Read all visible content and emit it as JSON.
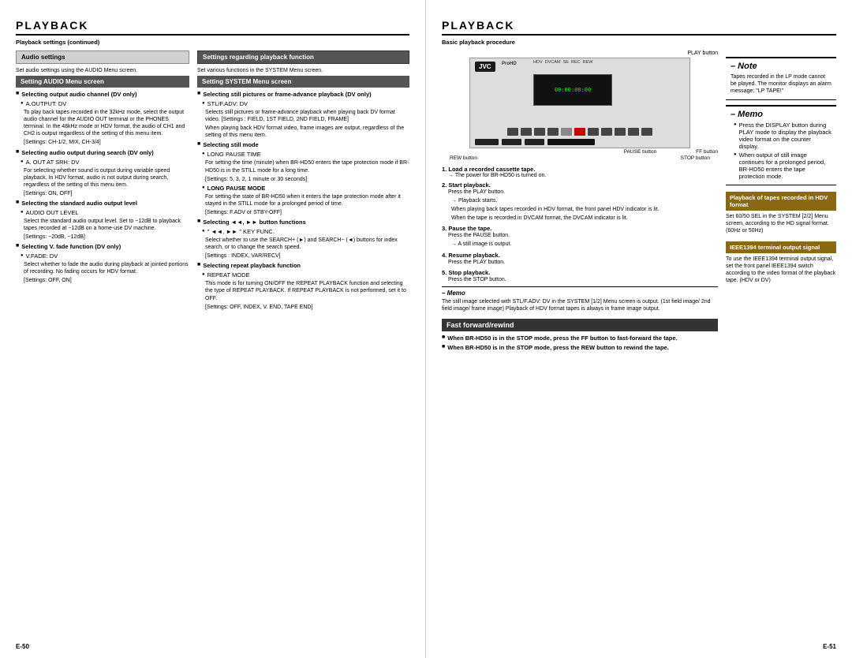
{
  "left_page": {
    "title": "PLAYBACK",
    "subtitle": "Playback settings (continued)",
    "audio_settings": {
      "heading": "Audio settings",
      "intro": "Set audio settings using the AUDIO Menu screen.",
      "setting_audio_menu": "Setting AUDIO Menu screen",
      "items": [
        {
          "heading": "Selecting output audio channel (DV only)",
          "sub": "A.OUTPUT: DV",
          "body": "To play back tapes recorded in the 32kHz mode, select the output audio channel for the AUDIO OUT terminal or the PHONES terminal. In the 48kHz mode or HDV format, the audio of CH1 and CH2 is output regardless of the setting of this menu item.",
          "settings": "[Settings: CH-1/2, MIX, CH-3/4]"
        },
        {
          "heading": "Selecting audio output during search (DV only)",
          "sub": "A. OUT AT SRH: DV",
          "body": "For selecting whether sound is output during variable speed playback. In HDV format, audio is not output during search, regardless of the setting of this menu item.",
          "settings": "[Settings: ON, OFF]"
        },
        {
          "heading": "Selecting the standard audio output level",
          "sub": "AUDIO OUT LEVEL",
          "body": "Select the standard audio output level.\nSet to −12dB to playback tapes recorded at −12dB on a home-use DV machine.",
          "settings": "[Settings: −20dB, −12dB]"
        },
        {
          "heading": "Selecting V. fade function (DV only)",
          "sub": "V.FADE: DV",
          "body": "Select whether to fade the audio during playback at jointed portions of recording. No fading occurs for HDV format.",
          "settings": "[Settings: OFF, ON]"
        }
      ]
    },
    "settings_function": {
      "heading": "Settings regarding playback function",
      "intro": "Set various functions in the SYSTEM Menu screen.",
      "setting_system_menu": "Setting SYSTEM Menu screen",
      "items": [
        {
          "heading": "Selecting still pictures or frame-advance playback (DV only)",
          "sub": "STL/F.ADV: DV",
          "body": "Selects still pictures or frame-advance playback when playing back DV format video.\n[Settings : FIELD, 1ST FIELD, 2ND FIELD, FRAME]",
          "note": "When playing back HDV format video, frame images are output, regardless of the setting of this menu item."
        },
        {
          "heading": "Selecting still mode",
          "sub": "LONG PAUSE TIME",
          "body": "For setting the time (minute) when BR-HD50 enters the tape protection mode if BR-HD50 is in the STILL mode for a long time.",
          "settings": "[Settings: 5, 3, 2, 1 minute or 30 seconds]"
        },
        {
          "heading": "LONG PAUSE MODE",
          "body": "For setting the state of BR-HD50 when it enters the tape protection mode after it stayed in the STILL mode for a prolonged period of time.",
          "settings": "[Settings: F.ADV or STBY-OFF]"
        },
        {
          "heading": "Selecting ◄◄, ►► button functions",
          "sub": "\" ◄◄, ►► \" KEY FUNC.",
          "body": "Select whether to use the SEARCH+ (►) and SEARCH− (◄) buttons for index search, or to change the search speed.",
          "settings": "[Settings : INDEX, VAR/RECV]"
        },
        {
          "heading": "Selecting repeat playback function",
          "sub": "REPEAT MODE",
          "body": "This mode is for turning ON/OFF the REPEAT PLAYBACK function and selecting the type of REPEAT PLAYBACK. If REPEAT PLAYBACK is not performed, set it to OFF.",
          "settings": "[Settings: OFF, INDEX, V. END, TAPE END]"
        }
      ]
    },
    "page_number": "E-50"
  },
  "right_page": {
    "title": "PLAYBACK",
    "subtitle": "Basic playback procedure",
    "device_labels": {
      "play_button": "PLAY button",
      "pause_button": "PAUSE button",
      "ff_button": "FF button",
      "rew_button": "REW button",
      "stop_button": "STOP button"
    },
    "steps": [
      {
        "num": "1.",
        "text": "Load a recorded cassette tape.",
        "arrow": "→ The power for BR-HD50 is turned on."
      },
      {
        "num": "2.",
        "text": "Start playback.",
        "body": "Press the PLAY button.",
        "sub_items": [
          "→ Playback starts.",
          "When playing back tapes recorded in HDV format, the front panel HDV indicator is lit.",
          "When the tape is recorded in DVCAM format, the DVCAM indicator is lit."
        ]
      },
      {
        "num": "3.",
        "text": "Pause the tape.",
        "body": "Press the PAUSE button.",
        "note": "→ A still image is output."
      },
      {
        "num": "4.",
        "text": "Resume playback.",
        "body": "Press the PLAY button."
      },
      {
        "num": "5.",
        "text": "Stop playback.",
        "body": "Press the STOP button."
      }
    ],
    "memo_stl": {
      "title": "– Memo",
      "body": "The still image selected with STL/F.ADV: DV in the SYSTEM [1/2] Menu screen is output. (1st field image/ 2nd field image/ frame image)\nPlayback of HDV format tapes is always in frame image output."
    },
    "note": {
      "title": "– Note",
      "body": "Tapes recorded in the LP mode cannot be played. The monitor displays an alarm message: \"LP TAPE!\""
    },
    "memo": {
      "title": "– Memo",
      "items": [
        "Press the DISPLAY button during PLAY mode to display the playback video format on the counter display.",
        "When output of still image continues for a prolonged period, BR-HD50 enters the tape protection mode."
      ]
    },
    "highlight1": {
      "heading": "Playback of tapes recorded in HDV format",
      "body": "Set 60/50 SEL in the SYSTEM [2/2] Menu screen, according to the HD signal format. (60Hz or 50Hz)"
    },
    "highlight2": {
      "heading": "IEEE1394 terminal output signal",
      "body": "To use the IEEE1394 terminal output signal, set the front panel IEEE1394 switch according to the video format of the playback tape. (HDV or DV)"
    },
    "fast_forward": {
      "heading": "Fast forward/rewind",
      "items": [
        "When BR-HD50 is in the STOP mode, press the FF button to fast-forward the tape.",
        "When BR-HD50 is in the STOP mode, press the REW button to rewind the tape."
      ]
    },
    "page_number": "E-51"
  }
}
